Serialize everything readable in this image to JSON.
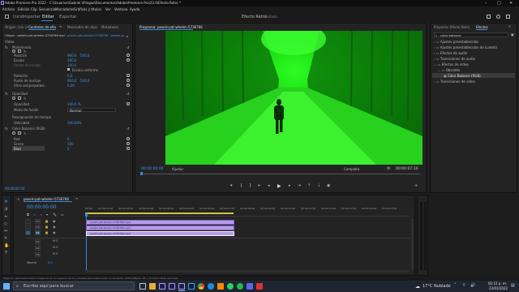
{
  "window": {
    "title": "Adobe Premiere Pro 2022 - C:\\Usuarios\\Gabriel Villegas\\Documentos\\Adobe\\Premiere Pro\\22.0\\Efecto Retro *"
  },
  "menu": [
    "Archivo",
    "Edición",
    "Clip",
    "Secuencia",
    "Marcadores",
    "Gráficos y títulos",
    "Ver",
    "Ventana",
    "Ayuda"
  ],
  "workspaces": {
    "items": [
      "Inicio",
      "Importar",
      "Editar",
      "Exportar"
    ],
    "active": "Editar",
    "project_title": "Efecto Retro",
    "status": "- Editado"
  },
  "effect_controls": {
    "tabs": [
      "Origen: (sin clips)",
      "Controles de efectos",
      "Mezclador de clips de audio",
      "Metadatos"
    ],
    "source": "Origen · pexels-pat-whelen-5736766.mp4",
    "sequence": "pexels-pat-whelen-5736766 · pexels-pat-wh...",
    "section_video": "Vídeo",
    "motion": "Movimiento",
    "rows": [
      {
        "label": "Posición",
        "v1": "960,0",
        "v2": "540,0"
      },
      {
        "label": "Escala",
        "v1": "100,0",
        "v2": ""
      },
      {
        "label": "Ancho de escala",
        "v1": "100,0",
        "v2": ""
      },
      {
        "label": "",
        "v1": "Escala uniforme",
        "v2": ""
      },
      {
        "label": "Rotación",
        "v1": "0,0",
        "v2": ""
      },
      {
        "label": "Punto de anclaje",
        "v1": "960,0",
        "v2": "540,0"
      },
      {
        "label": "Filtro antiparpadeo",
        "v1": "0,00",
        "v2": ""
      }
    ],
    "opacity": "Opacidad",
    "opacity_value_label": "Opacidad",
    "opacity_value": "100,0 %",
    "blend_label": "Modo de fusión",
    "blend_value": "Normal",
    "time_remap": "Reasignación de tiempo",
    "speed_label": "Velocidad",
    "speed_value": "100,00%",
    "color_balance": "Color Balance (RGB)",
    "red_label": "Red",
    "red_value": "0",
    "green_label": "Green",
    "green_value": "100",
    "blue_label": "Blue",
    "blue_value": "0",
    "timecode": "00:00:00:00"
  },
  "program": {
    "title": "Programa: pexels-pat-whelen-5736766",
    "timecode": "00:00:00:00",
    "fit": "Ajustar",
    "quality": "Completa",
    "duration": "00:00:07:10"
  },
  "project_panel": {
    "tabs": [
      "Proyecto: Efecto Retro",
      "Efectos"
    ],
    "search": "color balance",
    "tree": [
      "Ajustes preestablecidos",
      "Ajustes preestablecidos de Lumetri",
      "Efectos de audio",
      "Transiciones de audio",
      "Efectos de vídeo",
      "Obsoleto",
      "Color Balance (RGB)",
      "Transiciones de vídeo"
    ]
  },
  "timeline": {
    "tab": "pexels-pat-whelen-5736766",
    "timecode": "00:00:00:00",
    "ruler": [
      "00:00",
      "00:00:01:00",
      "00:00:02:00",
      "00:00:03:00",
      "00:00:04:00",
      "00:00:05:00",
      "00:00:06:00",
      "00:00:07:00",
      "00:00:08:00",
      "00:00:09:00",
      "00:00:10:00",
      "00:00:11:00",
      "00:00:12:00",
      "00:00:13:00",
      "00:00:14:00",
      "00:00:15:00"
    ],
    "tracks_video": [
      "V3",
      "V2",
      "V1"
    ],
    "tracks_audio": [
      "A1",
      "A2",
      "A3"
    ],
    "mix": "Mezcla",
    "mix_value": "0,0",
    "clips": [
      "pexels-pat-whelen-5736766.mp4",
      "pexels-pat-whelen-5736766.mp4",
      "pexels-pat-whelen-5736766.mp4"
    ]
  },
  "status": "Haga clic para seleccionar o haga clic en un espacio vacío y arrastre para seleccionar un recuadro. Utilice Mayús, Alt y Ctrl para otras opciones.",
  "taskbar": {
    "search_placeholder": "Escribe aquí para buscar",
    "weather": "17°C Nublado",
    "time": "02:12 p. m.",
    "date": "23/01/2022"
  },
  "colors": {
    "accent": "#2d8ceb",
    "clip": "#b59be6",
    "video_green": "#18d012"
  }
}
